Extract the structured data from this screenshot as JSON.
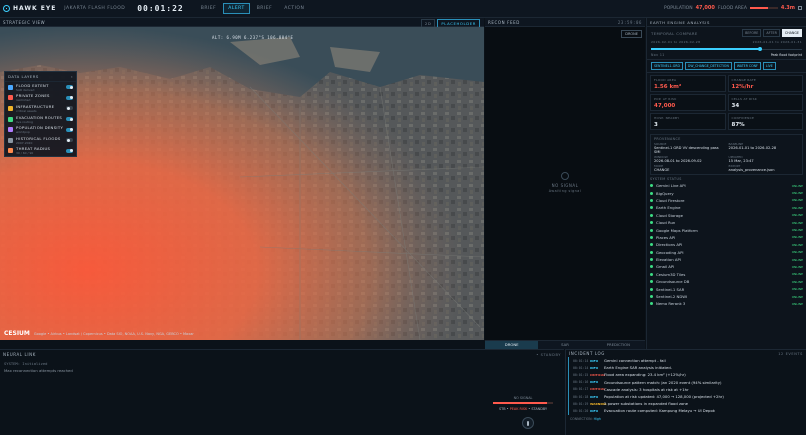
{
  "app": {
    "name": "HAWK EYE",
    "subtitle": "JAKARTA FLASH FLOOD",
    "clock": "00:01:22",
    "tabs": [
      {
        "label": "BRIEF",
        "active": false
      },
      {
        "label": "ALERT",
        "active": true
      },
      {
        "label": "BRIEF",
        "active": false
      },
      {
        "label": "ACTION",
        "active": false
      }
    ],
    "population_label": "POPULATION",
    "population_value": "47,000",
    "flood_label": "FLOOD AREA",
    "flood_value": "4.3m",
    "flood_level": 0.65
  },
  "strategic": {
    "title": "STRATEGIC VIEW",
    "btn_2d": "2D",
    "btn_placeholder": "PLACEHOLDER",
    "coord": "ALT: 6.90M    6.237°S 106.804°E",
    "credit_logo": "CESIUM",
    "credit_text": "Google • Airbus • Landsat / Copernicus • Data SIO, NOAA, U.S. Navy, NGA, GEBCO • Maxar"
  },
  "layers": {
    "title": "DATA LAYERS",
    "items": [
      {
        "name": "FLOOD EXTENT",
        "sub": "SAR derived",
        "color": "#4aa8ff",
        "on": true
      },
      {
        "name": "PRIVATE ZONES",
        "sub": "restricted",
        "color": "#ff5a4d",
        "on": true
      },
      {
        "name": "INFRASTRUCTURE",
        "sub": "critical assets",
        "color": "#f0b429",
        "on": false
      },
      {
        "name": "EVACUATION ROUTES",
        "sub": "live routing",
        "color": "#3ddc84",
        "on": true
      },
      {
        "name": "POPULATION DENSITY",
        "sub": "worldpop",
        "color": "#b07cff",
        "on": true
      },
      {
        "name": "HISTORICAL FLOODS",
        "sub": "2007-2020",
        "color": "#8a96a2",
        "on": false
      },
      {
        "name": "THREAT RADIUS",
        "sub": "30 / 60 / 90",
        "color": "#ff8a4d",
        "on": true
      }
    ]
  },
  "recon": {
    "title": "RECON FEED",
    "time": "23:59:06",
    "button": "DRONE",
    "center_title": "NO SIGNAL",
    "center_sub": "Awaiting signal",
    "tabs": [
      {
        "label": "DRONE",
        "active": true
      },
      {
        "label": "SAR",
        "active": false
      },
      {
        "label": "PREDICTION",
        "active": false
      }
    ]
  },
  "ee": {
    "title": "EARTH ENGINE ANALYSIS",
    "temporal_label": "TEMPORAL COMPARE",
    "chips": [
      {
        "label": "BEFORE",
        "active": false
      },
      {
        "label": "AFTER",
        "active": false
      },
      {
        "label": "CHANGE",
        "active": true
      }
    ],
    "date_left": "2026-02-01 to 2026-02-28",
    "date_right": "2026-01-01 to 2026-01-31",
    "slider_value": 0.72,
    "slider_left": "Nov 11",
    "slider_right": "Peak flood footprint",
    "tags": [
      "SENTINEL1-GRD",
      "DW_CHANGE_DETECTION",
      "WATER CONF",
      "LIVE"
    ],
    "stats": [
      {
        "label": "FLOOD AREA",
        "value": "1.56 km²",
        "red": true
      },
      {
        "label": "CHANGE RATE",
        "value": "12%/hr",
        "red": true
      },
      {
        "label": "POP. AT RISK",
        "value": "47,000",
        "red": true
      },
      {
        "label": "CELLS AT RISK",
        "value": "34",
        "red": false
      },
      {
        "label": "HOSP. NEARBY",
        "value": "3",
        "red": false
      },
      {
        "label": "CONFIDENCE",
        "value": "87%",
        "red": false
      }
    ],
    "provenance_title": "PROVENANCE",
    "provenance": [
      {
        "label": "SOURCE",
        "value": "Sentinel-1 GRD VV descending pass SMI"
      },
      {
        "label": "BASELINE",
        "value": "2026-01-01 to 2026-02-28"
      },
      {
        "label": "WINDOW",
        "value": "2026-08-01 to 2026-09-02"
      },
      {
        "label": "UPDATED",
        "value": "15 Mar, 23:47"
      },
      {
        "label": "MODE",
        "value": "CHANGE"
      },
      {
        "label": "EXPORT",
        "value": "analysis_provenance.json"
      }
    ],
    "system_title": "SYSTEM STATUS",
    "services": [
      "Gemini Live API",
      "BigQuery",
      "Cloud Firestore",
      "Earth Engine",
      "Cloud Storage",
      "Cloud Run",
      "Google Maps Platform",
      "Places API",
      "Directions API",
      "Geocoding API",
      "Elevation API",
      "Gmail API",
      "Cesium3D Tiles",
      "Groundsource DB",
      "Sentinel-1 SAR",
      "Sentinel-2 NDWI",
      "Nemo Rerank 3"
    ],
    "service_status": "ONLINE"
  },
  "neural": {
    "title": "NEURAL LINK",
    "right": "• STANDBY",
    "line1": "SYSTEM: Initialized",
    "line2": "Max reconnection attempts reached",
    "mic_label": "NO SIGNAL",
    "mic_level": 0.9,
    "mic_status_a": "STB",
    "mic_status_b": "PEAK RISK",
    "mic_status_c": "STANDBY"
  },
  "incident": {
    "title": "INCIDENT LOG",
    "right": "12 EVENTS",
    "rows": [
      {
        "time": "00:01:14",
        "tag": "INFO",
        "color": "#3cd0ff",
        "msg": "Gemini connection attempt - fail"
      },
      {
        "time": "00:01:14",
        "tag": "INFO",
        "color": "#3cd0ff",
        "msg": "Earth Engine SAR analysis initiated."
      },
      {
        "time": "00:01:15",
        "tag": "CRITICAL",
        "color": "#ff5a4d",
        "msg": "Flood area expanding: 23.4 km² (+12%/hr)"
      },
      {
        "time": "00:01:16",
        "tag": "INFO",
        "color": "#3cd0ff",
        "msg": "Groundsource pattern match: Jan 2020 event (94% similarity)"
      },
      {
        "time": "00:01:17",
        "tag": "CRITICAL",
        "color": "#ff5a4d",
        "msg": "Cascade analysis: 3 hospitals at risk at +1hr"
      },
      {
        "time": "00:01:18",
        "tag": "INFO",
        "color": "#3cd0ff",
        "msg": "Population at risk updated: 47,000 → 128,000 (projected +2hr)"
      },
      {
        "time": "00:01:19",
        "tag": "WARNING",
        "color": "#f0b429",
        "msg": "2 power substations in expanded flood zone"
      },
      {
        "time": "00:01:20",
        "tag": "INFO",
        "color": "#3cd0ff",
        "msg": "Evacuation route computed: Kampung Melayu → UI Depok"
      }
    ],
    "foot_label": "CONNECTION:",
    "foot_value": "High"
  }
}
